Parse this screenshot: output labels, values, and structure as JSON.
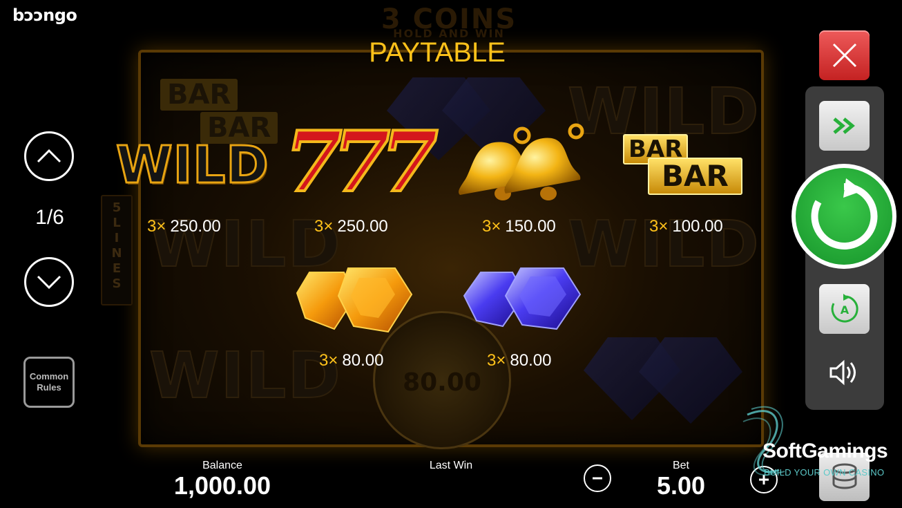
{
  "brand": "bɔɔngo",
  "title": "PAYTABLE",
  "pagination": {
    "current": "1/6"
  },
  "common_rules": {
    "line1": "Common",
    "line2": "Rules"
  },
  "background": {
    "logo_main": "3 COINS",
    "logo_sub": "HOLD AND WIN",
    "lines_label": "5 LINES",
    "coin_value": "80.00",
    "ghost_wild": "WILD",
    "ghost_bar": "BAR"
  },
  "symbols": [
    {
      "name": "wild",
      "text": "WILD",
      "multiplier": "3×",
      "payout": "250.00"
    },
    {
      "name": "sevens",
      "text": "777",
      "multiplier": "3×",
      "payout": "250.00"
    },
    {
      "name": "bells",
      "multiplier": "3×",
      "payout": "150.00"
    },
    {
      "name": "bar-bar",
      "bar_top": "BAR",
      "bar_bottom": "BAR",
      "multiplier": "3×",
      "payout": "100.00"
    },
    {
      "name": "orange-gems",
      "multiplier": "3×",
      "payout": "80.00"
    },
    {
      "name": "blue-gems",
      "multiplier": "3×",
      "payout": "80.00"
    }
  ],
  "bottom_bar": {
    "balance_label": "Balance",
    "balance_value": "1,000.00",
    "last_win_label": "Last Win",
    "bet_label": "Bet",
    "bet_value": "5.00"
  },
  "watermark": {
    "name": "SoftGamings",
    "tagline": "BUILD YOUR OWN CASINO"
  },
  "colors": {
    "gold": "#ffc21a",
    "close_red": "#d93a3a",
    "spin_green": "#22a835",
    "panel_gray": "#3c3c3c"
  },
  "icons": {
    "up": "chevron-up-icon",
    "down": "chevron-down-icon",
    "close": "close-icon",
    "turbo": "fast-forward-icon",
    "spin": "spin-icon",
    "autoplay": "autoplay-icon",
    "sound": "sound-icon",
    "coins": "coins-icon",
    "minus": "minus-icon",
    "plus": "plus-icon"
  }
}
